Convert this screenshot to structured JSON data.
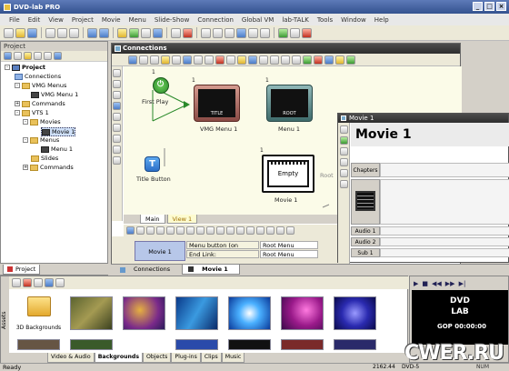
{
  "app": {
    "title": "DVD-lab PRO"
  },
  "menu": [
    "File",
    "Edit",
    "View",
    "Project",
    "Movie",
    "Menu",
    "Slide-Show",
    "Connection",
    "Global VM",
    "lab-TALK",
    "Tools",
    "Window",
    "Help"
  ],
  "project": {
    "header": "Project",
    "tree": [
      {
        "label": "Project",
        "bold": true
      },
      {
        "label": "Connections"
      },
      {
        "label": "VMG Menus"
      },
      {
        "label": "VMG Menu 1"
      },
      {
        "label": "Commands"
      },
      {
        "label": "VTS 1"
      },
      {
        "label": "Movies"
      },
      {
        "label": "Movie 1"
      },
      {
        "label": "Menus"
      },
      {
        "label": "Menu 1"
      },
      {
        "label": "Slides"
      },
      {
        "label": "Commands"
      }
    ],
    "tab": "Project"
  },
  "connections": {
    "title": "Connections",
    "nodes": {
      "first_play": "First Play",
      "title_button": "Title Button",
      "vmg_menu": "VMG Menu 1",
      "vmg_title": "TITLE",
      "vmg_num": "1",
      "menu1": "Menu 1",
      "menu1_root": "ROOT",
      "menu1_num": "1",
      "movie1": "Movie 1",
      "movie1_empty": "Empty",
      "movie1_num": "1",
      "root_tag": "Root",
      "first_play_num": "1"
    },
    "tabs": [
      "Main",
      "View 1"
    ],
    "link": {
      "name": "Movie 1",
      "rows": [
        {
          "label": "Menu button (on remote):",
          "value": "Root Menu"
        },
        {
          "label": "End Link:",
          "value": "Root Menu"
        }
      ]
    }
  },
  "movie": {
    "window_title": "Movie 1",
    "heading": "Movie 1",
    "tracks": [
      "Chapters",
      "Audio 1",
      "Audio 2",
      "Sub 1"
    ]
  },
  "doc_tabs": [
    "Connections",
    "Movie 1"
  ],
  "assets": {
    "side_label": "Assets",
    "first_item": "3D Backgrounds",
    "tabs": [
      "Video & Audio",
      "Backgrounds",
      "Objects",
      "Plug-ins",
      "Clips",
      "Music"
    ],
    "active_tab": "Backgrounds"
  },
  "preview": {
    "gop": "GOP 00:00:00",
    "logo": "DVD LAB"
  },
  "status": {
    "text": "Ready",
    "left_info": "2162.44",
    "dvd": "DVD-5",
    "num": "NUM"
  },
  "watermark": "CWER.RU"
}
